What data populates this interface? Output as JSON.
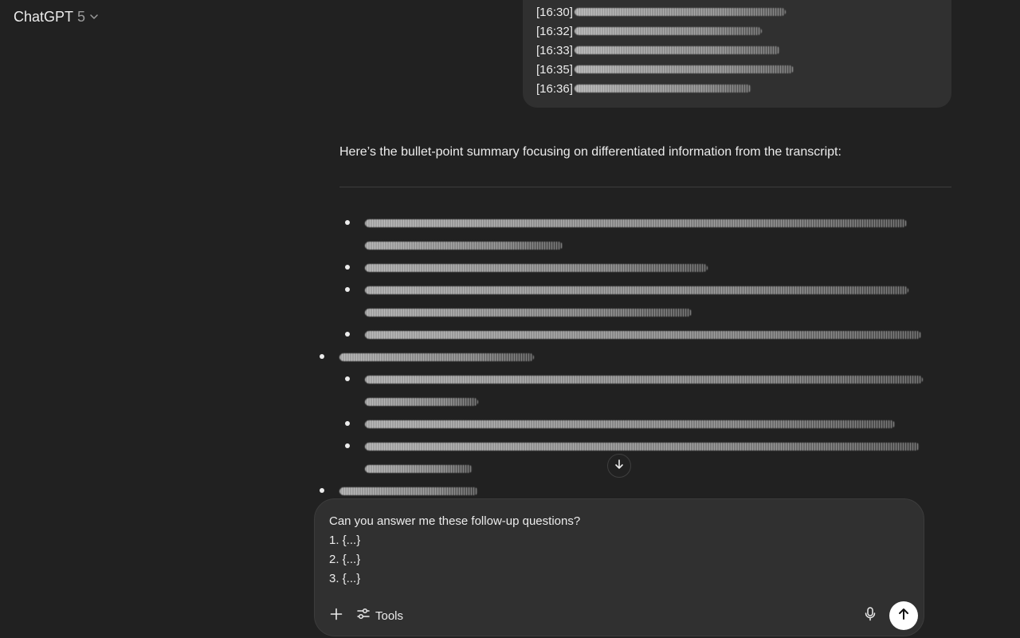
{
  "header": {
    "model_name": "ChatGPT",
    "model_version": "5",
    "chevron_icon": "chevron-down-icon"
  },
  "user_message": {
    "timestamps": [
      "[16:30]",
      "[16:32]",
      "[16:33]",
      "[16:35]",
      "[16:36]"
    ]
  },
  "assistant_message": {
    "intro": "Here’s the bullet-point summary focusing on differentiated information from the transcript:"
  },
  "scroll_button": {
    "icon": "arrow-down-icon"
  },
  "composer": {
    "lines": [
      "Can you answer me these follow-up questions?",
      "1. {...}",
      "2. {...}",
      "3. {...}"
    ],
    "tools_label": "Tools",
    "icons": {
      "add": "plus-icon",
      "tools": "sliders-icon",
      "mic": "microphone-icon",
      "send": "arrow-up-icon"
    }
  },
  "colors": {
    "background": "#212121",
    "bubble": "#303030",
    "text": "#ececec",
    "muted": "#9b9b9b",
    "send_button": "#ffffff"
  }
}
